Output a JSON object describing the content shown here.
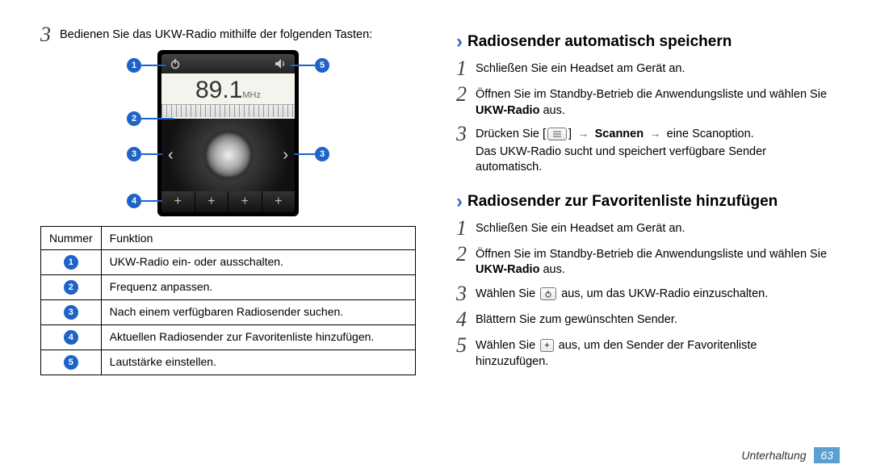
{
  "left": {
    "step3": "Bedienen Sie das UKW-Radio mithilfe der folgenden Tasten:",
    "radio": {
      "freq": "89.1",
      "unit": "MHz"
    },
    "table": {
      "head_num": "Nummer",
      "head_fn": "Funktion",
      "rows": [
        "UKW-Radio ein- oder ausschalten.",
        "Frequenz anpassen.",
        "Nach einem verfügbaren Radiosender suchen.",
        "Aktuellen Radiosender zur Favoritenliste hinzufügen.",
        "Lautstärke einstellen."
      ]
    }
  },
  "right": {
    "sectionA_title": "Radiosender automatisch speichern",
    "sectionA": {
      "s1": "Schließen Sie ein Headset am Gerät an.",
      "s2a": "Öffnen Sie im Standby-Betrieb die Anwendungsliste und wählen Sie ",
      "s2b": "UKW-Radio",
      "s2c": " aus.",
      "s3a": "Drücken Sie [",
      "s3b": "] ",
      "s3c": "Scannen",
      "s3d": " eine Scanoption.",
      "s3sub": "Das UKW-Radio sucht und speichert verfügbare Sender automatisch."
    },
    "sectionB_title": "Radiosender zur Favoritenliste hinzufügen",
    "sectionB": {
      "s1": "Schließen Sie ein Headset am Gerät an.",
      "s2a": "Öffnen Sie im Standby-Betrieb die Anwendungsliste und wählen Sie ",
      "s2b": "UKW-Radio",
      "s2c": " aus.",
      "s3a": "Wählen Sie ",
      "s3b": " aus, um das UKW-Radio einzuschalten.",
      "s4": "Blättern Sie zum gewünschten Sender.",
      "s5a": "Wählen Sie ",
      "s5b": " aus, um den Sender der Favoritenliste hinzuzufügen."
    }
  },
  "footer": {
    "section": "Unterhaltung",
    "page": "63"
  }
}
